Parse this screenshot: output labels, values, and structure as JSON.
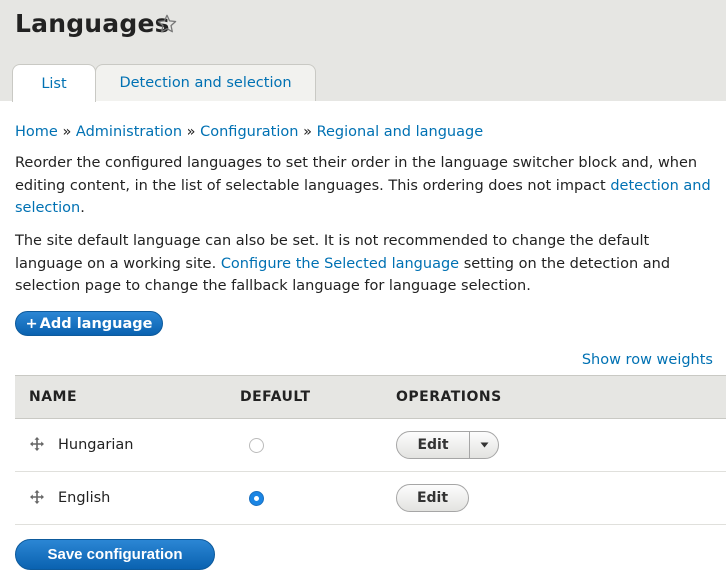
{
  "page": {
    "title": "Languages",
    "icons": {
      "favorite": "star-outline-icon",
      "drag": "drag-handle-icon",
      "dropdown": "caret-down-icon"
    }
  },
  "tabs": [
    {
      "label": "List",
      "active": true
    },
    {
      "label": "Detection and selection",
      "active": false
    }
  ],
  "breadcrumb": {
    "items": [
      "Home",
      "Administration",
      "Configuration",
      "Regional and language"
    ],
    "separator": "»"
  },
  "description": {
    "p1_text": "Reorder the configured languages to set their order in the language switcher block and, when editing content, in the list of selectable languages. This ordering does not impact ",
    "p1_link": "detection and selection",
    "p1_end": ".",
    "p2_text": "The site default language can also be set. It is not recommended to change the default language on a working site. ",
    "p2_link": "Configure the Selected language",
    "p2_end": " setting on the detection and selection page to change the fallback language for language selection."
  },
  "actions": {
    "add_language": "Add language",
    "add_symbol": "+",
    "show_row_weights": "Show row weights",
    "save": "Save configuration"
  },
  "table": {
    "headers": {
      "name": "NAME",
      "default": "DEFAULT",
      "operations": "OPERATIONS"
    },
    "rows": [
      {
        "name": "Hungarian",
        "default": false,
        "operation": "Edit",
        "has_dropdown": true
      },
      {
        "name": "English",
        "default": true,
        "operation": "Edit",
        "has_dropdown": false
      }
    ]
  },
  "colors": {
    "accent": "#0071b3",
    "primary_button": "#0a6fc2",
    "header_bg": "#e6e6e3",
    "radio_checked": "#1a85e4"
  }
}
